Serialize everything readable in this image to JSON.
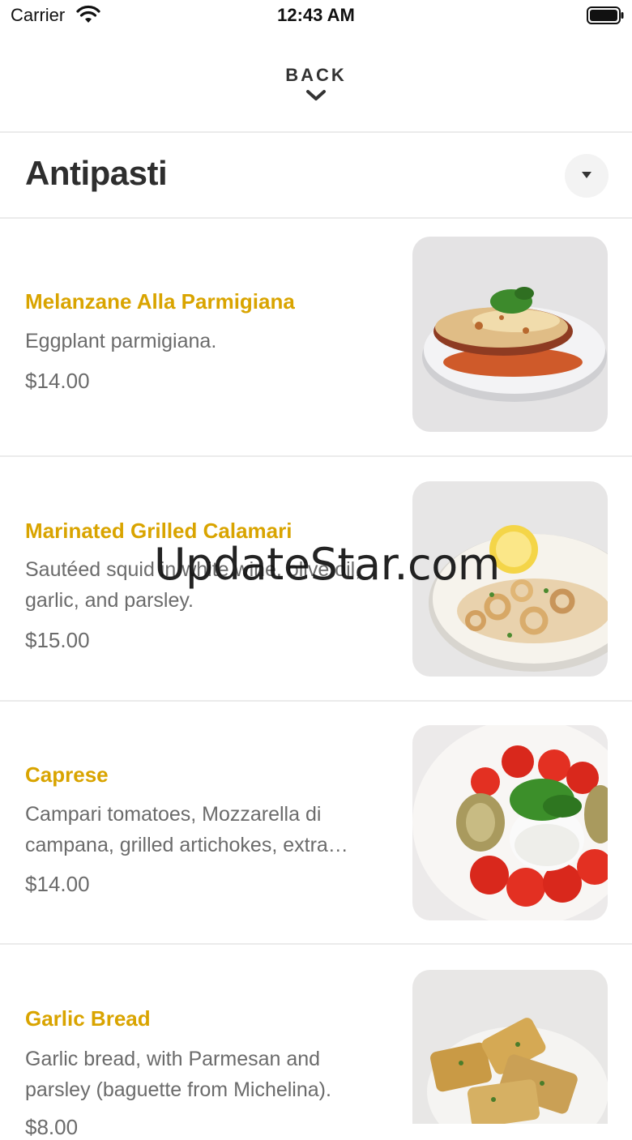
{
  "status_bar": {
    "carrier": "Carrier",
    "time": "12:43 AM"
  },
  "header": {
    "back_label": "BACK"
  },
  "section": {
    "title": "Antipasti"
  },
  "items": [
    {
      "name": "Melanzane Alla Parmigiana",
      "description": "Eggplant parmigiana.",
      "price": "$14.00",
      "photo": "eggplant-parmigiana-photo"
    },
    {
      "name": "Marinated Grilled Calamari",
      "description": "Sautéed squid in white wine, olive oil, garlic, and parsley.",
      "price": "$15.00",
      "photo": "grilled-calamari-photo"
    },
    {
      "name": "Caprese",
      "description": "Campari tomatoes, Mozzarella di campana, grilled artichokes, extra virgin olive oil and basil.",
      "price": "$14.00",
      "photo": "caprese-photo"
    },
    {
      "name": "Garlic Bread",
      "description": "Garlic bread, with Parmesan and parsley (baguette from Michelina).",
      "price": "$8.00",
      "photo": "garlic-bread-photo"
    }
  ],
  "watermark": "UpdateStar.com",
  "colors": {
    "accent": "#d9a400",
    "text_primary": "#2e2e2e",
    "text_secondary": "#6b6b6b",
    "divider": "#ebebeb"
  }
}
